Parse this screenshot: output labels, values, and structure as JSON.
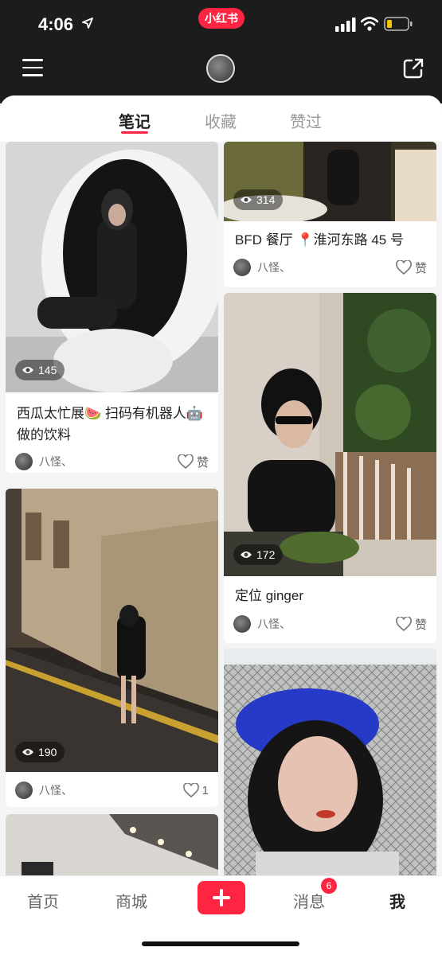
{
  "status_bar": {
    "time": "4:06",
    "app_name": "小红书"
  },
  "tabs": [
    {
      "label": "笔记",
      "active": true
    },
    {
      "label": "收藏",
      "active": false
    },
    {
      "label": "赞过",
      "active": false
    }
  ],
  "notes": [
    {
      "views": "145",
      "title": "西瓜太忙展🍉 扫码有机器人🤖做的饮料",
      "author": "八怪、",
      "like_label": "赞"
    },
    {
      "views": "314",
      "title": "BFD 餐厅 📍淮河东路 45 号",
      "author": "八怪、",
      "like_label": "赞"
    },
    {
      "views": "172",
      "title": "定位 ginger",
      "author": "八怪、",
      "like_label": "赞"
    },
    {
      "views": "190",
      "title": "",
      "author": "八怪、",
      "like_label": "1"
    }
  ],
  "bottom_nav": {
    "home": "首页",
    "mall": "商城",
    "messages": "消息",
    "messages_badge": "6",
    "me": "我"
  },
  "colors": {
    "accent": "#ff2442",
    "header_bg": "#1c1c1c"
  }
}
